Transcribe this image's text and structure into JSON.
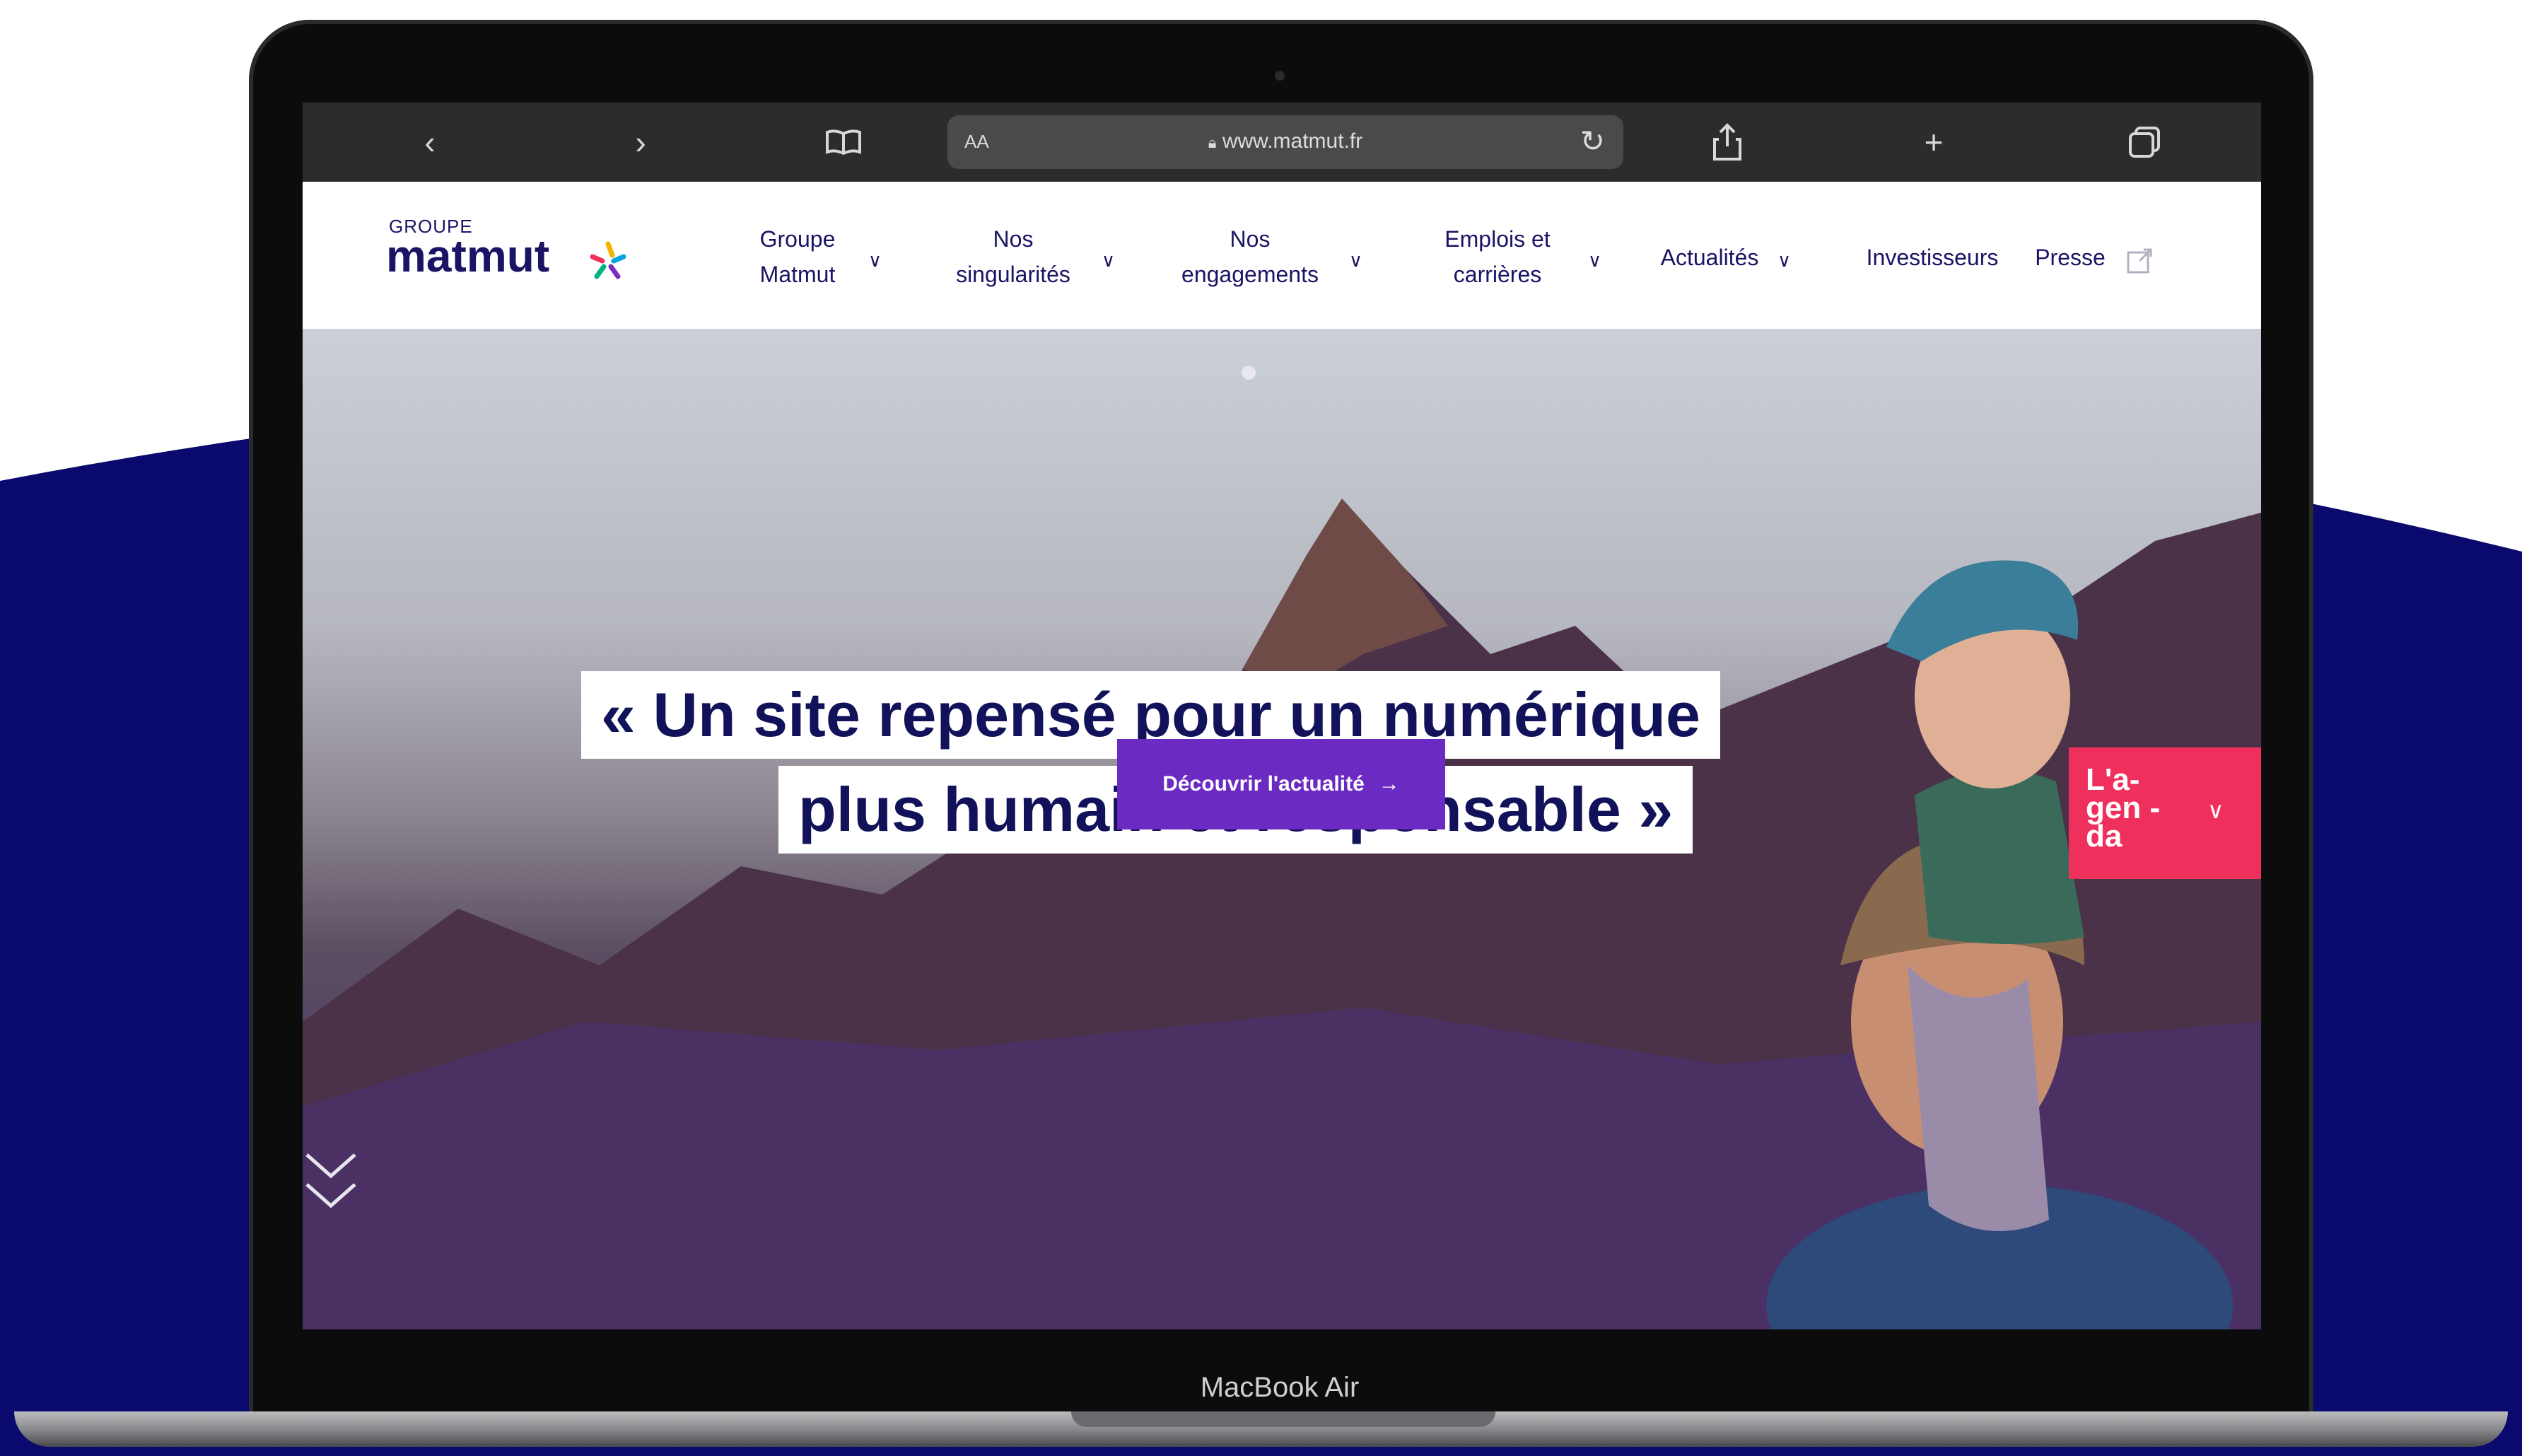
{
  "colors": {
    "background_wave": "#0a0a6e",
    "brand_navy": "#1a1464",
    "cta_purple": "#6b2ac2",
    "agenda_pink": "#f0305c"
  },
  "browser": {
    "url_aa": "AA",
    "url": "www.matmut.fr",
    "icons": [
      "back-icon",
      "forward-icon",
      "bookmarks-icon",
      "lock-icon",
      "reload-icon",
      "share-icon",
      "new-tab-icon",
      "tabs-icon"
    ]
  },
  "header": {
    "logo_small": "GROUPE",
    "logo_main": "matmut",
    "nav": [
      {
        "line1": "Groupe",
        "line2": "Matmut"
      },
      {
        "line1": "Nos",
        "line2": "singularités"
      },
      {
        "line1": "Nos",
        "line2": "engagements"
      },
      {
        "line1": "Emplois et",
        "line2": "carrières"
      },
      {
        "line1": "Actualités",
        "line2": ""
      },
      {
        "line1": "Investisseurs",
        "line2": ""
      },
      {
        "line1": "Presse",
        "line2": ""
      }
    ]
  },
  "hero": {
    "quote_line1": "« Un site repensé pour un numérique",
    "quote_line2": "plus humain et responsable »",
    "cta_label": "Découvrir l'actualité",
    "agenda_label": "L'a- gen -da"
  },
  "device": {
    "label": "MacBook Air"
  }
}
